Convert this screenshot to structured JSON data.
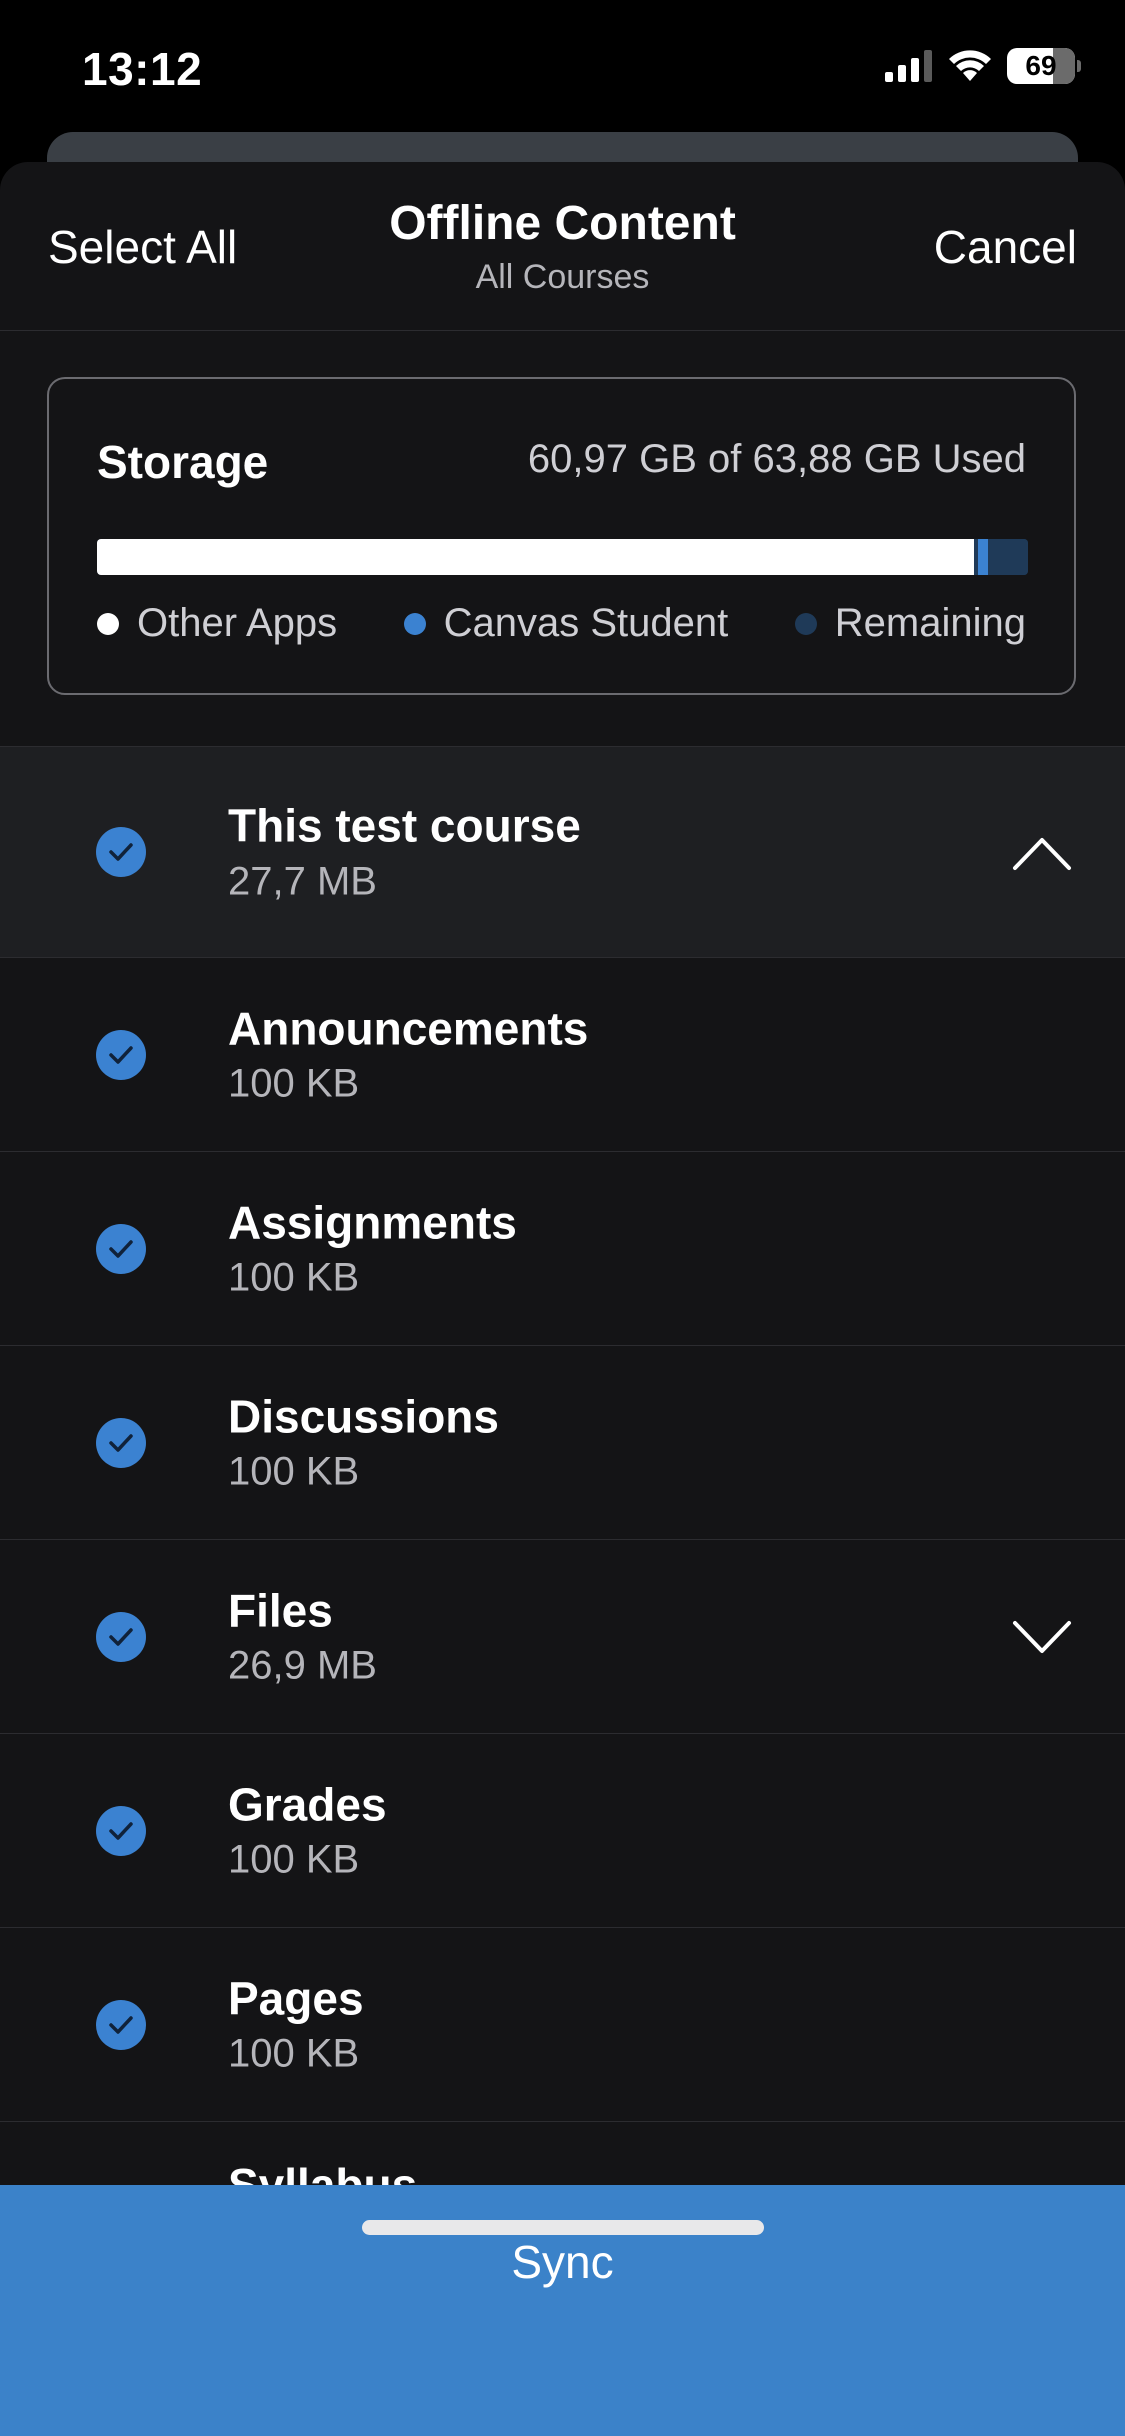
{
  "status_bar": {
    "time": "13:12",
    "battery": "69",
    "icons": [
      "cellular-signal-icon",
      "wifi-icon",
      "battery-icon"
    ]
  },
  "nav": {
    "left": "Select All",
    "title": "Offline Content",
    "subtitle": "All Courses",
    "right": "Cancel"
  },
  "storage": {
    "title": "Storage",
    "used_text": "60,97 GB of 63,88 GB Used",
    "used_gb": 60.97,
    "total_gb": 63.88,
    "legend": [
      {
        "label": "Other Apps",
        "color": "#ffffff"
      },
      {
        "label": "Canvas Student",
        "color": "#3b82d1"
      },
      {
        "label": "Remaining",
        "color": "#1f3a58"
      }
    ]
  },
  "course": {
    "title": "This test course",
    "size": "27,7 MB",
    "expanded": true
  },
  "items": [
    {
      "title": "Announcements",
      "size": "100 KB"
    },
    {
      "title": "Assignments",
      "size": "100 KB"
    },
    {
      "title": "Discussions",
      "size": "100 KB"
    },
    {
      "title": "Files",
      "size": "26,9 MB",
      "expandable": true
    },
    {
      "title": "Grades",
      "size": "100 KB"
    },
    {
      "title": "Pages",
      "size": "100 KB"
    }
  ],
  "partial_item": {
    "title": "Syllabus"
  },
  "sync": {
    "label": "Sync"
  },
  "colors": {
    "accent": "#3b82d1",
    "sheet_bg": "#141416",
    "course_row_bg": "#1e1f22"
  }
}
